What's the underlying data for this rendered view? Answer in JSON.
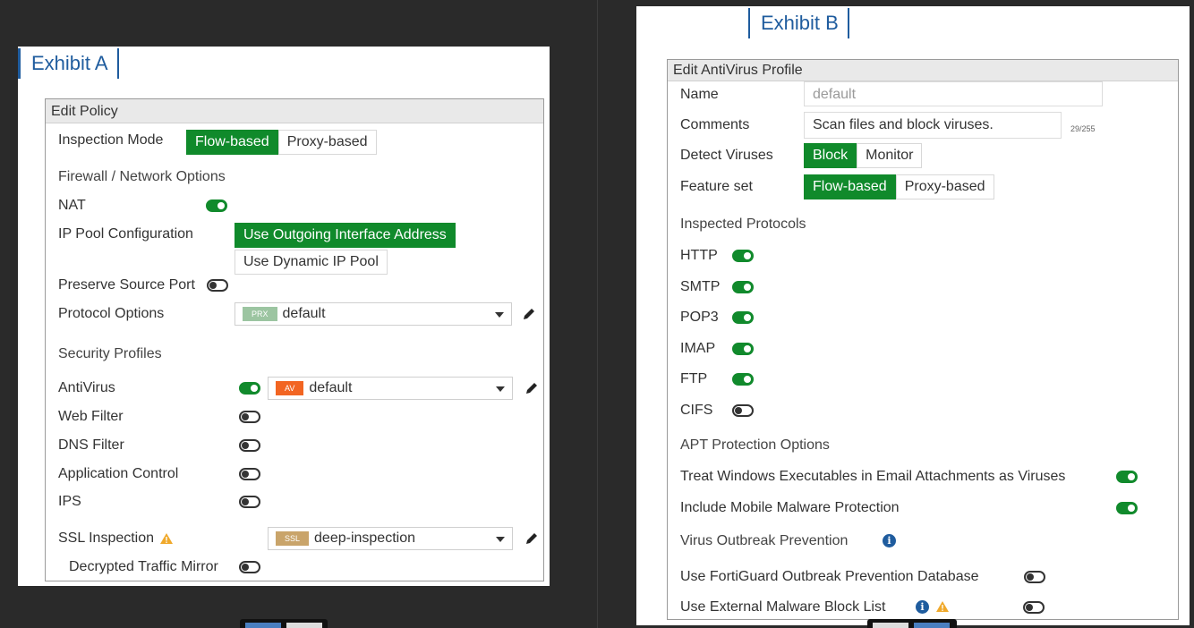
{
  "exhibit_a": {
    "tab_label": "Exhibit A",
    "header": "Edit Policy",
    "inspection_mode": {
      "label": "Inspection Mode",
      "options": [
        "Flow-based",
        "Proxy-based"
      ],
      "selected": "Flow-based"
    },
    "firewall_section": "Firewall / Network Options",
    "nat": {
      "label": "NAT",
      "enabled": true
    },
    "ip_pool": {
      "label": "IP Pool Configuration",
      "options": [
        "Use Outgoing Interface Address",
        "Use Dynamic IP Pool"
      ],
      "selected": "Use Outgoing Interface Address"
    },
    "preserve_source_port": {
      "label": "Preserve Source Port",
      "enabled": false
    },
    "protocol_options": {
      "label": "Protocol Options",
      "badge": "PRX",
      "value": "default"
    },
    "security_section": "Security Profiles",
    "antivirus": {
      "label": "AntiVirus",
      "enabled": true,
      "badge": "AV",
      "value": "default"
    },
    "web_filter": {
      "label": "Web Filter",
      "enabled": false
    },
    "dns_filter": {
      "label": "DNS Filter",
      "enabled": false
    },
    "app_control": {
      "label": "Application Control",
      "enabled": false
    },
    "ips": {
      "label": "IPS",
      "enabled": false
    },
    "ssl_inspection": {
      "label": "SSL Inspection",
      "badge": "SSL",
      "value": "deep-inspection"
    },
    "decrypted_mirror": {
      "label": "Decrypted Traffic Mirror",
      "enabled": false
    }
  },
  "exhibit_b": {
    "tab_label": "Exhibit B",
    "header": "Edit AntiVirus Profile",
    "name": {
      "label": "Name",
      "value": "default"
    },
    "comments": {
      "label": "Comments",
      "value": "Scan files and block viruses.",
      "counter": "29/255"
    },
    "detect_viruses": {
      "label": "Detect Viruses",
      "options": [
        "Block",
        "Monitor"
      ],
      "selected": "Block"
    },
    "feature_set": {
      "label": "Feature set",
      "options": [
        "Flow-based",
        "Proxy-based"
      ],
      "selected": "Flow-based"
    },
    "protocols_section": "Inspected Protocols",
    "protocols": [
      {
        "label": "HTTP",
        "enabled": true
      },
      {
        "label": "SMTP",
        "enabled": true
      },
      {
        "label": "POP3",
        "enabled": true
      },
      {
        "label": "IMAP",
        "enabled": true
      },
      {
        "label": "FTP",
        "enabled": true
      },
      {
        "label": "CIFS",
        "enabled": false
      }
    ],
    "apt_section": "APT Protection Options",
    "treat_windows_exec": {
      "label": "Treat Windows Executables in Email Attachments as Viruses",
      "enabled": true
    },
    "mobile_malware": {
      "label": "Include Mobile Malware Protection",
      "enabled": true
    },
    "outbreak_section": "Virus Outbreak Prevention",
    "fortiguard_db": {
      "label": "Use FortiGuard Outbreak Prevention Database",
      "enabled": false
    },
    "external_blocklist": {
      "label": "Use External Malware Block List",
      "enabled": false
    }
  },
  "colors": {
    "accent_green": "#108a2b",
    "link_blue": "#1f5c9e",
    "av_badge": "#f26522",
    "prx_badge": "#9cc5a1",
    "ssl_badge": "#c9a46a"
  },
  "icons": [
    "edit-pencil-icon",
    "warning-icon",
    "info-icon",
    "dropdown-caret-icon"
  ]
}
